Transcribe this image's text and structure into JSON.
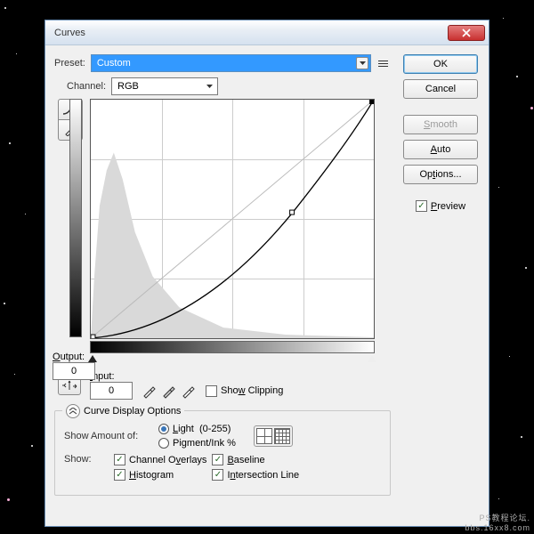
{
  "window": {
    "title": "Curves"
  },
  "preset": {
    "label": "Preset:",
    "value": "Custom"
  },
  "channel": {
    "label": "Channel:",
    "value": "RGB"
  },
  "buttons": {
    "ok": "OK",
    "cancel": "Cancel",
    "smooth": "Smooth",
    "auto": "Auto",
    "options": "Options..."
  },
  "preview": {
    "label": "Preview"
  },
  "output": {
    "label": "Output:",
    "value": "0"
  },
  "input": {
    "label": "Input:",
    "value": "0"
  },
  "show_clipping": {
    "label": "Show Clipping"
  },
  "display_options": {
    "legend": "Curve Display Options"
  },
  "show_amount": {
    "label": "Show Amount of:",
    "light": "Light  (0-255)",
    "pigment": "Pigment/Ink %"
  },
  "show": {
    "label": "Show:",
    "channel_overlays": "Channel Overlays",
    "baseline": "Baseline",
    "histogram": "Histogram",
    "intersection": "Intersection Line"
  },
  "watermark": {
    "line1": "PS教程论坛.",
    "line2": "bbs.16xx8.com"
  },
  "chart_data": {
    "type": "line",
    "title": "Curves",
    "xlabel": "Input",
    "ylabel": "Output",
    "xlim": [
      0,
      255
    ],
    "ylim": [
      0,
      255
    ],
    "series": [
      {
        "name": "baseline",
        "x": [
          0,
          255
        ],
        "y": [
          0,
          255
        ]
      },
      {
        "name": "curve",
        "x": [
          0,
          64,
          128,
          182,
          255
        ],
        "y": [
          0,
          18,
          62,
          135,
          255
        ]
      }
    ],
    "control_point": {
      "x": 182,
      "y": 135
    },
    "histogram_peak_x": 20
  }
}
